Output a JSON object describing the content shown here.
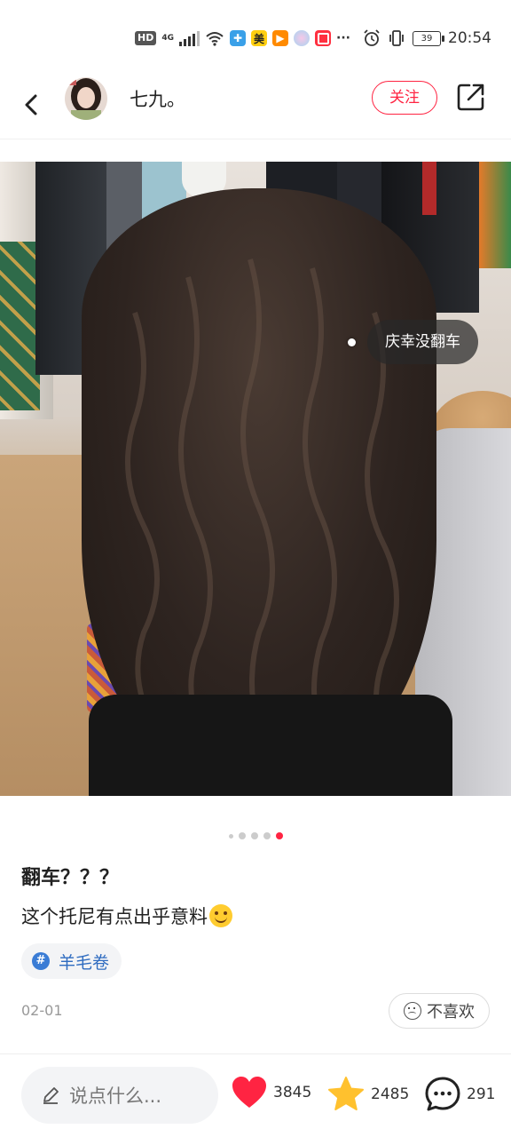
{
  "status_bar": {
    "left_badges": [
      "HD",
      "4G"
    ],
    "app_icons": [
      {
        "name": "cross-app-icon",
        "color": "#3aa0e8"
      },
      {
        "name": "meituan-app-icon",
        "color": "#ffcf10",
        "label": "美"
      },
      {
        "name": "video-app-icon",
        "color": "#ff8a00"
      },
      {
        "name": "orb-app-icon",
        "color": "#d8a3e8"
      },
      {
        "name": "red-app-icon",
        "color": "#ff3040"
      }
    ],
    "more": "···",
    "battery": "39",
    "time": "20:54"
  },
  "header": {
    "username": "七九。",
    "follow_label": "关注"
  },
  "photo": {
    "tag_label": "庆幸没翻车",
    "page_count": 5,
    "active_page": 5
  },
  "post": {
    "title": "翻车？？？",
    "description": "这个托尼有点出乎意料",
    "topic_icon": "#",
    "topic": "羊毛卷",
    "date": "02-01",
    "dislike_label": "不喜欢"
  },
  "bottom_bar": {
    "comment_placeholder": "说点什么...",
    "likes": "3845",
    "collects": "2485",
    "comments": "291"
  },
  "colors": {
    "accent": "#ff2442",
    "star": "#ffc12e",
    "topic": "#2f6cc0"
  }
}
